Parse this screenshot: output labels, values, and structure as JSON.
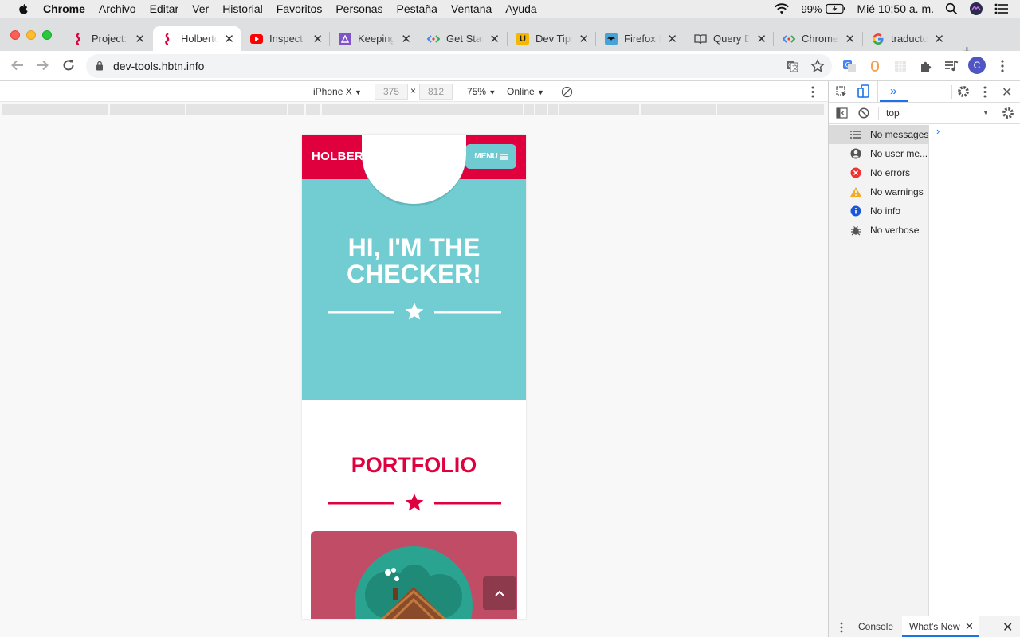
{
  "menubar": {
    "app": "Chrome",
    "items": [
      "Archivo",
      "Editar",
      "Ver",
      "Historial",
      "Favoritos",
      "Personas",
      "Pestaña",
      "Ventana",
      "Ayuda"
    ],
    "battery": "99%",
    "clock": "Mié 10:50 a. m."
  },
  "tabs": [
    {
      "title": "Project:",
      "icon": "holberton-icon"
    },
    {
      "title": "Holberton",
      "icon": "holberton-icon",
      "active": true
    },
    {
      "title": "Inspect f",
      "icon": "youtube-icon"
    },
    {
      "title": "Keeping",
      "icon": "keeping-icon"
    },
    {
      "title": "Get Star",
      "icon": "devtools-icon"
    },
    {
      "title": "Dev Tips",
      "icon": "dev-tips-icon"
    },
    {
      "title": "Firefox D",
      "icon": "firefox-icon"
    },
    {
      "title": "Query D",
      "icon": "book-icon"
    },
    {
      "title": "Chrome",
      "icon": "devtools-icon"
    },
    {
      "title": "traducto",
      "icon": "google-icon"
    }
  ],
  "toolbar": {
    "url": "dev-tools.hbtn.info",
    "profile_initial": "C"
  },
  "device_toolbar": {
    "device": "iPhone X",
    "width": "375",
    "height": "812",
    "zoom": "75%",
    "network": "Online"
  },
  "page": {
    "logo": "HOLBERTON ME",
    "menu_label": "MENU",
    "hero_title": "HI, I'M THE CHECKER!",
    "portfolio_title": "PORTFOLIO",
    "scroll_top_icon": "chevron-up-icon"
  },
  "devtools": {
    "context": "top",
    "filters": [
      {
        "label": "No messages",
        "icon": "list-icon",
        "selected": true
      },
      {
        "label": "No user me...",
        "icon": "user-icon"
      },
      {
        "label": "No errors",
        "icon": "error-icon"
      },
      {
        "label": "No warnings",
        "icon": "warning-icon"
      },
      {
        "label": "No info",
        "icon": "info-icon"
      },
      {
        "label": "No verbose",
        "icon": "bug-icon"
      }
    ],
    "drawer_tabs": [
      "Console",
      "What's New"
    ]
  },
  "colors": {
    "brand_red": "#e0003e",
    "hero_teal": "#72cdd2",
    "card_rose": "#c14c66"
  }
}
